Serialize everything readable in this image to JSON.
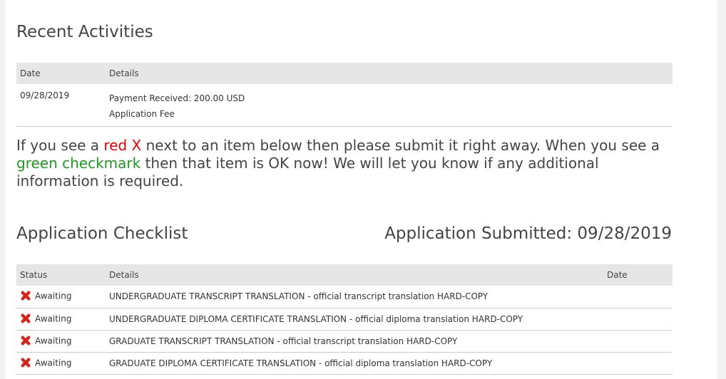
{
  "recent": {
    "title": "Recent Activities",
    "headers": {
      "date": "Date",
      "details": "Details"
    },
    "rows": [
      {
        "date": "09/28/2019",
        "line1": "Payment Received: 200.00 USD",
        "line2": "Application Fee"
      }
    ]
  },
  "notice": {
    "part1": "If you see a ",
    "red_text": "red X",
    "part2": " next to an item below then please submit it right away. When you see a ",
    "green_text": "green checkmark",
    "part3": " then that item is OK now!  We will let you know if any additional information is required.",
    "red_color": "#e60000",
    "green_color": "#1f9a1f"
  },
  "checklist": {
    "title": "Application Checklist",
    "submitted": "Application Submitted: 09/28/2019",
    "headers": {
      "status": "Status",
      "details": "Details",
      "date": "Date"
    },
    "rows": [
      {
        "icon": "red-x-icon",
        "status": "Awaiting",
        "details": "UNDERGRADUATE TRANSCRIPT TRANSLATION - official transcript translation HARD-COPY",
        "date": ""
      },
      {
        "icon": "red-x-icon",
        "status": "Awaiting",
        "details": "UNDERGRADUATE DIPLOMA CERTIFICATE TRANSLATION - official diploma translation HARD-COPY",
        "date": ""
      },
      {
        "icon": "red-x-icon",
        "status": "Awaiting",
        "details": "GRADUATE TRANSCRIPT TRANSLATION - official transcript translation HARD-COPY",
        "date": ""
      },
      {
        "icon": "red-x-icon",
        "status": "Awaiting",
        "details": "GRADUATE DIPLOMA CERTIFICATE TRANSLATION - official diploma translation HARD-COPY",
        "date": ""
      }
    ]
  }
}
